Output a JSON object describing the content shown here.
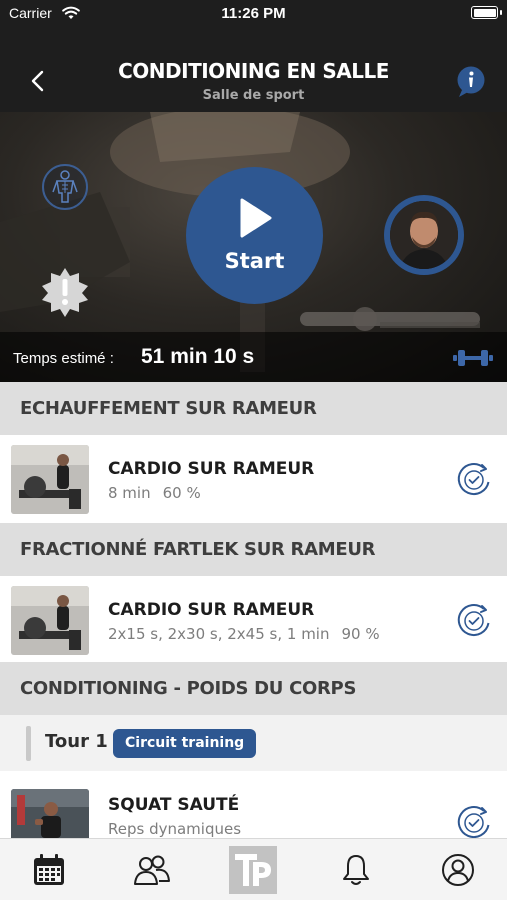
{
  "status_bar": {
    "carrier": "Carrier",
    "time": "11:26 PM",
    "wifi_icon": "wifi-icon",
    "battery_icon": "battery-icon"
  },
  "nav": {
    "title": "CONDITIONING EN SALLE",
    "subtitle": "Salle de sport",
    "back_icon": "chevron-left-icon",
    "info_icon": "info-icon"
  },
  "hero": {
    "start_label": "Start",
    "estimated_time_label": "Temps estimé :",
    "estimated_time_value": "51 min 10 s",
    "icons": [
      "muscle-body-icon",
      "warning-badge-icon",
      "play-icon",
      "coach-avatar",
      "dumbbell-icon"
    ]
  },
  "sections": [
    {
      "title": "ECHAUFFEMENT SUR RAMEUR",
      "exercises": [
        {
          "title": "CARDIO SUR RAMEUR",
          "duration": "8 min",
          "intensity": "60 %"
        }
      ]
    },
    {
      "title": "FRACTIONNÉ FARTLEK SUR RAMEUR",
      "exercises": [
        {
          "title": "CARDIO SUR RAMEUR",
          "duration": "2x15 s, 2x30 s, 2x45 s, 1 min",
          "intensity": "90 %"
        }
      ]
    },
    {
      "title": "CONDITIONING - POIDS DU CORPS",
      "round": {
        "label": "Tour 1",
        "badge": "Circuit training"
      },
      "exercises": [
        {
          "title": "SQUAT SAUTÉ",
          "duration": "Reps dynamiques",
          "intensity": ""
        }
      ]
    }
  ],
  "tab_bar": [
    "calendar-icon",
    "community-icon",
    "tp-logo-icon",
    "bell-icon",
    "profile-icon"
  ],
  "colors": {
    "brand_blue": "#2e5791",
    "header_dark": "#1e1e1e",
    "section_gray": "#dedede"
  }
}
